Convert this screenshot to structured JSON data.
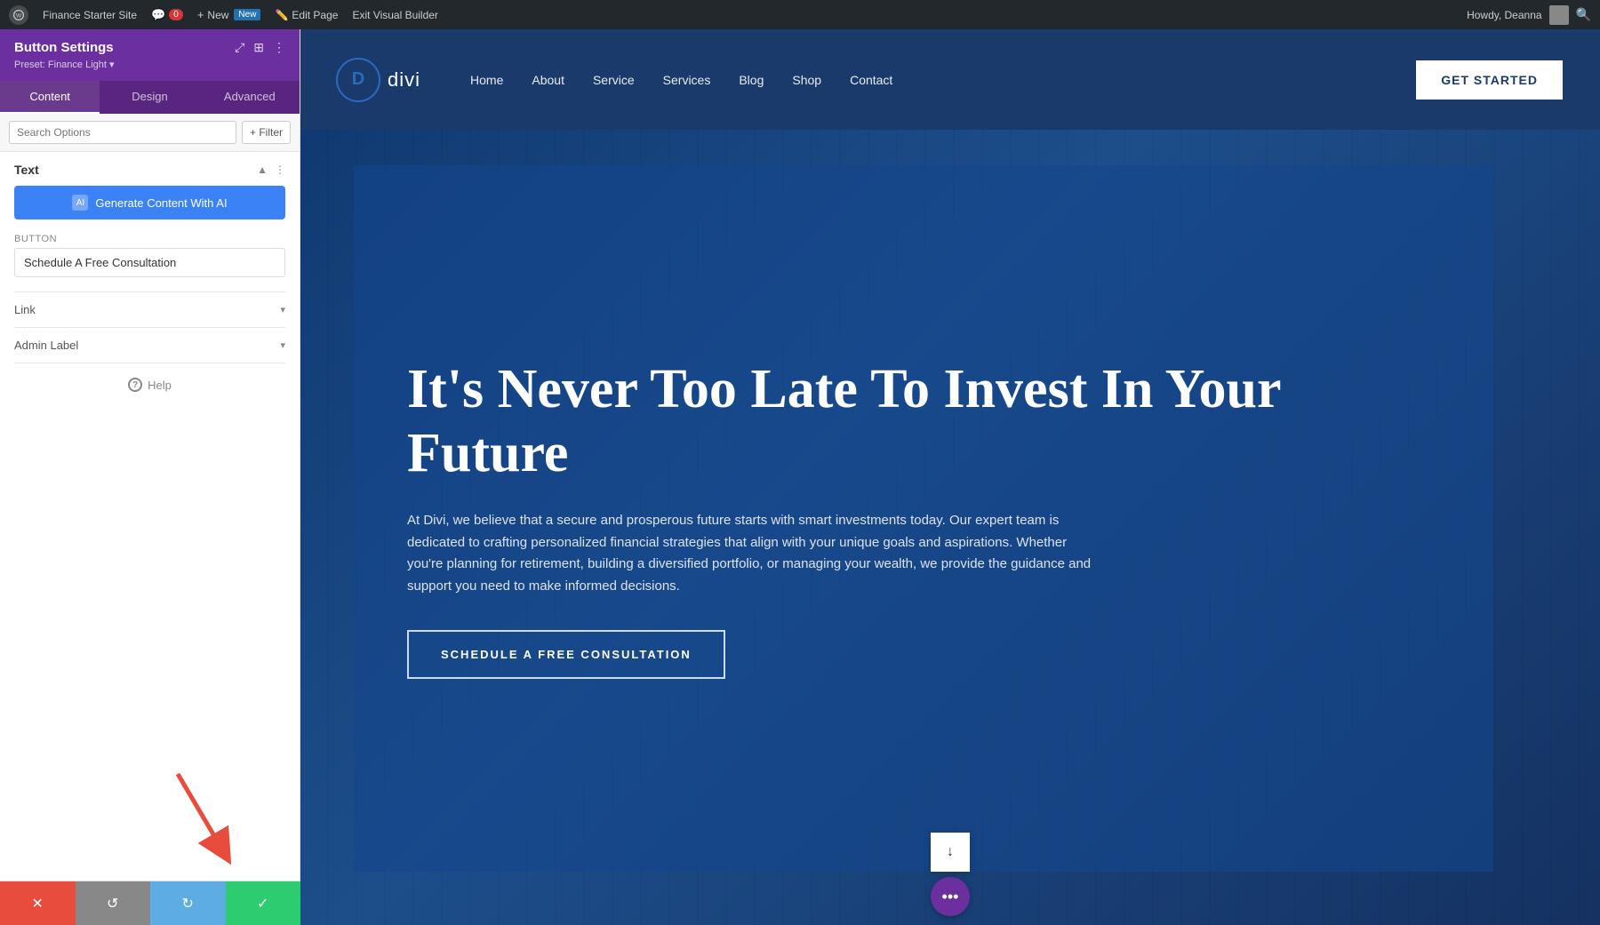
{
  "admin_bar": {
    "site_name": "Finance Starter Site",
    "comment_count": "0",
    "new_label": "New",
    "edit_page_label": "Edit Page",
    "exit_builder_label": "Exit Visual Builder",
    "howdy_text": "Howdy, Deanna"
  },
  "panel": {
    "title": "Button Settings",
    "preset": "Preset: Finance Light ▾",
    "tabs": [
      "Content",
      "Design",
      "Advanced"
    ],
    "active_tab": "Content",
    "search_placeholder": "Search Options",
    "filter_label": "+ Filter",
    "section_text_title": "Text",
    "ai_btn_label": "Generate Content With AI",
    "field_button_label": "Button",
    "button_value": "Schedule A Free Consultation",
    "link_section_label": "Link",
    "admin_label_section": "Admin Label",
    "help_label": "Help"
  },
  "bottom_bar": {
    "cancel_icon": "✕",
    "undo_icon": "↺",
    "redo_icon": "↻",
    "save_icon": "✓"
  },
  "site": {
    "logo_letter": "D",
    "logo_name": "divi",
    "nav_items": [
      "Home",
      "About",
      "Service",
      "Services",
      "Blog",
      "Shop",
      "Contact"
    ],
    "get_started_label": "GET STARTED",
    "hero_title": "It's Never Too Late To Invest In Your Future",
    "hero_description": "At Divi, we believe that a secure and prosperous future starts with smart investments today. Our expert team is dedicated to crafting personalized financial strategies that align with your unique goals and aspirations. Whether you're planning for retirement, building a diversified portfolio, or managing your wealth, we provide the guidance and support you need to make informed decisions.",
    "hero_cta_label": "SCHEDULE A FREE CONSULTATION",
    "scroll_icon": "↓",
    "dot_menu_icon": "•••"
  }
}
